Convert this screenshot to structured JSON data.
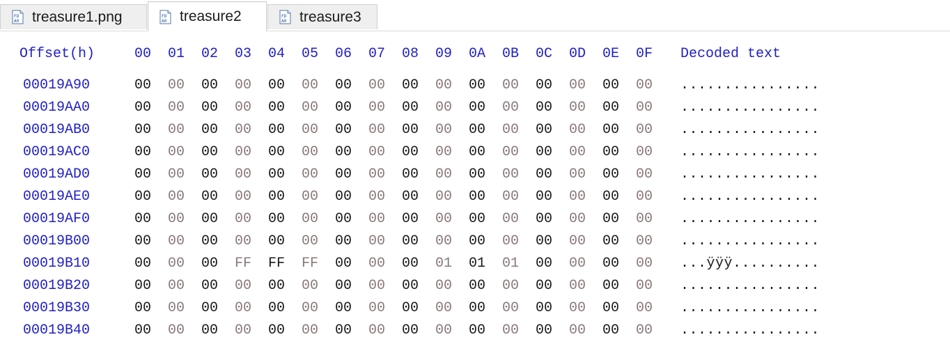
{
  "tabs": [
    {
      "label": "treasure1.png",
      "active": false
    },
    {
      "label": "treasure2",
      "active": true
    },
    {
      "label": "treasure3",
      "active": false
    }
  ],
  "header": {
    "offset_label": "Offset(h)",
    "columns": [
      "00",
      "01",
      "02",
      "03",
      "04",
      "05",
      "06",
      "07",
      "08",
      "09",
      "0A",
      "0B",
      "0C",
      "0D",
      "0E",
      "0F"
    ],
    "decoded_label": "Decoded text"
  },
  "rows": [
    {
      "offset": "00019A90",
      "bytes": [
        "00",
        "00",
        "00",
        "00",
        "00",
        "00",
        "00",
        "00",
        "00",
        "00",
        "00",
        "00",
        "00",
        "00",
        "00",
        "00"
      ],
      "decoded": "................"
    },
    {
      "offset": "00019AA0",
      "bytes": [
        "00",
        "00",
        "00",
        "00",
        "00",
        "00",
        "00",
        "00",
        "00",
        "00",
        "00",
        "00",
        "00",
        "00",
        "00",
        "00"
      ],
      "decoded": "................"
    },
    {
      "offset": "00019AB0",
      "bytes": [
        "00",
        "00",
        "00",
        "00",
        "00",
        "00",
        "00",
        "00",
        "00",
        "00",
        "00",
        "00",
        "00",
        "00",
        "00",
        "00"
      ],
      "decoded": "................"
    },
    {
      "offset": "00019AC0",
      "bytes": [
        "00",
        "00",
        "00",
        "00",
        "00",
        "00",
        "00",
        "00",
        "00",
        "00",
        "00",
        "00",
        "00",
        "00",
        "00",
        "00"
      ],
      "decoded": "................"
    },
    {
      "offset": "00019AD0",
      "bytes": [
        "00",
        "00",
        "00",
        "00",
        "00",
        "00",
        "00",
        "00",
        "00",
        "00",
        "00",
        "00",
        "00",
        "00",
        "00",
        "00"
      ],
      "decoded": "................"
    },
    {
      "offset": "00019AE0",
      "bytes": [
        "00",
        "00",
        "00",
        "00",
        "00",
        "00",
        "00",
        "00",
        "00",
        "00",
        "00",
        "00",
        "00",
        "00",
        "00",
        "00"
      ],
      "decoded": "................"
    },
    {
      "offset": "00019AF0",
      "bytes": [
        "00",
        "00",
        "00",
        "00",
        "00",
        "00",
        "00",
        "00",
        "00",
        "00",
        "00",
        "00",
        "00",
        "00",
        "00",
        "00"
      ],
      "decoded": "................"
    },
    {
      "offset": "00019B00",
      "bytes": [
        "00",
        "00",
        "00",
        "00",
        "00",
        "00",
        "00",
        "00",
        "00",
        "00",
        "00",
        "00",
        "00",
        "00",
        "00",
        "00"
      ],
      "decoded": "................"
    },
    {
      "offset": "00019B10",
      "bytes": [
        "00",
        "00",
        "00",
        "FF",
        "FF",
        "FF",
        "00",
        "00",
        "00",
        "01",
        "01",
        "01",
        "00",
        "00",
        "00",
        "00"
      ],
      "decoded": "...ÿÿÿ.........."
    },
    {
      "offset": "00019B20",
      "bytes": [
        "00",
        "00",
        "00",
        "00",
        "00",
        "00",
        "00",
        "00",
        "00",
        "00",
        "00",
        "00",
        "00",
        "00",
        "00",
        "00"
      ],
      "decoded": "................"
    },
    {
      "offset": "00019B30",
      "bytes": [
        "00",
        "00",
        "00",
        "00",
        "00",
        "00",
        "00",
        "00",
        "00",
        "00",
        "00",
        "00",
        "00",
        "00",
        "00",
        "00"
      ],
      "decoded": "................"
    },
    {
      "offset": "00019B40",
      "bytes": [
        "00",
        "00",
        "00",
        "00",
        "00",
        "00",
        "00",
        "00",
        "00",
        "00",
        "00",
        "00",
        "00",
        "00",
        "00",
        "00"
      ],
      "decoded": "................"
    }
  ],
  "colors": {
    "offset_blue": "#2020c8",
    "even_byte": "#1a1a1a",
    "odd_byte": "#8a7878"
  }
}
